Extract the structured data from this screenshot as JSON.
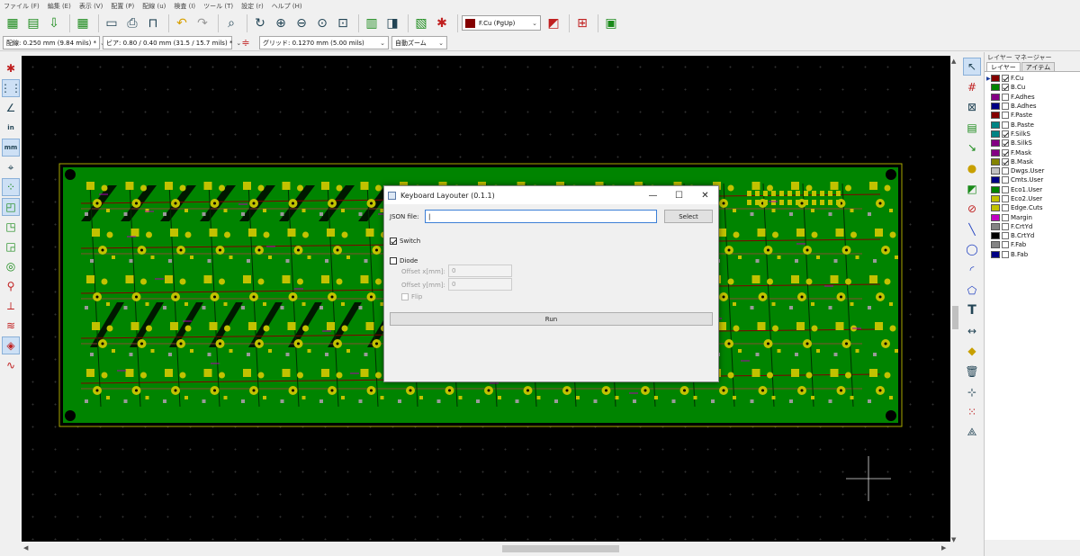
{
  "menu": [
    "ファイル (F)",
    "編集 (E)",
    "表示 (V)",
    "配置 (P)",
    "配線 (u)",
    "検査 (I)",
    "ツール (T)",
    "設定 (r)",
    "ヘルプ (H)"
  ],
  "toolbar": {
    "active_layer": "F.Cu (PgUp)",
    "active_layer_color": "#840000"
  },
  "options": {
    "track": "配線: 0.250 mm (9.84 mils) *",
    "via": "ビア: 0.80 / 0.40 mm (31.5 / 15.7 mils) *",
    "grid": "グリッド: 0.1270 mm (5.00 mils)",
    "zoom": "自動ズーム"
  },
  "left_tools": {
    "inch": "in",
    "mm": "mm"
  },
  "right_tools": {
    "text_glyph": "T"
  },
  "layer_manager": {
    "title": "レイヤー マネージャー",
    "tabs": [
      "レイヤー",
      "アイテム"
    ],
    "layers": [
      {
        "name": "F.Cu",
        "color": "#840000",
        "visible": true
      },
      {
        "name": "B.Cu",
        "color": "#008400",
        "visible": true
      },
      {
        "name": "F.Adhes",
        "color": "#840084",
        "visible": false
      },
      {
        "name": "B.Adhes",
        "color": "#000084",
        "visible": false
      },
      {
        "name": "F.Paste",
        "color": "#840000",
        "visible": false
      },
      {
        "name": "B.Paste",
        "color": "#008484",
        "visible": false
      },
      {
        "name": "F.SilkS",
        "color": "#008484",
        "visible": true
      },
      {
        "name": "B.SilkS",
        "color": "#840084",
        "visible": true
      },
      {
        "name": "F.Mask",
        "color": "#840084",
        "visible": true
      },
      {
        "name": "B.Mask",
        "color": "#848400",
        "visible": true
      },
      {
        "name": "Dwgs.User",
        "color": "#c2c2c2",
        "visible": false
      },
      {
        "name": "Cmts.User",
        "color": "#000084",
        "visible": false
      },
      {
        "name": "Eco1.User",
        "color": "#008400",
        "visible": false
      },
      {
        "name": "Eco2.User",
        "color": "#c2c200",
        "visible": false
      },
      {
        "name": "Edge.Cuts",
        "color": "#c2c200",
        "visible": false
      },
      {
        "name": "Margin",
        "color": "#c200c2",
        "visible": false
      },
      {
        "name": "F.CrtYd",
        "color": "#848484",
        "visible": false
      },
      {
        "name": "B.CrtYd",
        "color": "#000000",
        "visible": false
      },
      {
        "name": "F.Fab",
        "color": "#848484",
        "visible": false
      },
      {
        "name": "B.Fab",
        "color": "#000084",
        "visible": false
      }
    ]
  },
  "dialog": {
    "title": "Keyboard Layouter (0.1.1)",
    "json_label": "JSON file:",
    "json_value": "",
    "select_label": "Select",
    "switch_label": "Switch",
    "switch_checked": true,
    "diode_label": "Diode",
    "diode_checked": false,
    "offset_x_label": "Offset x[mm]:",
    "offset_x_value": "0",
    "offset_y_label": "Offset y[mm]:",
    "offset_y_value": "0",
    "flip_label": "Flip",
    "run_label": "Run"
  },
  "colors": {
    "canvas_bg": "#000000",
    "board_green": "#008400",
    "pad_yellow": "#c2c200",
    "track_red": "#840000"
  }
}
